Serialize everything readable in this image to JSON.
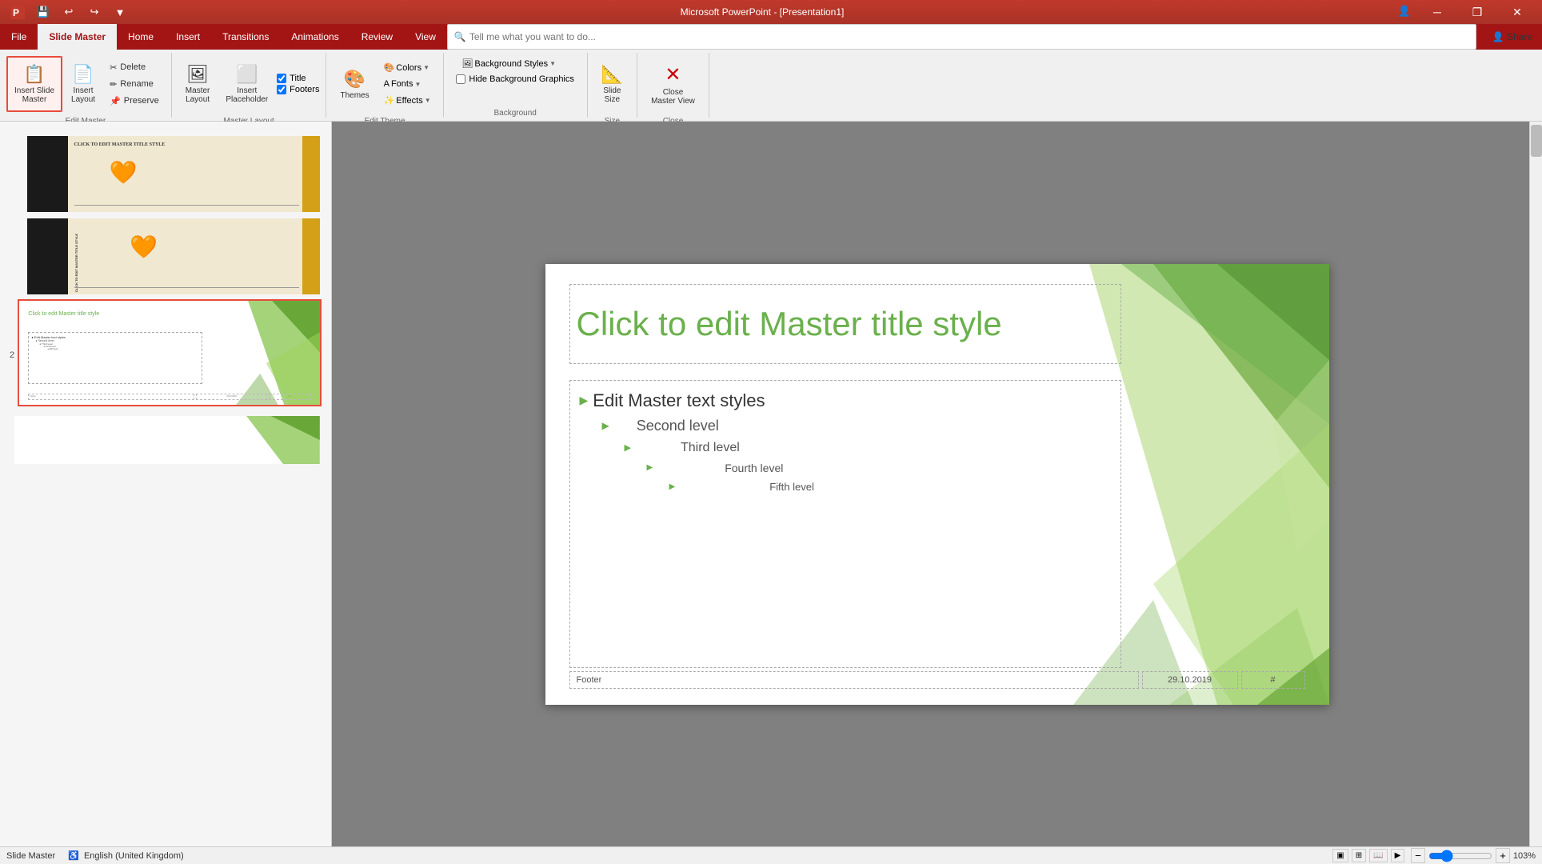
{
  "titleBar": {
    "title": "Microsoft PowerPoint - [Presentation1]",
    "quickAccess": [
      "save",
      "undo",
      "redo",
      "customize"
    ],
    "windowControls": [
      "minimize",
      "restore",
      "close"
    ]
  },
  "ribbon": {
    "tabs": [
      "File",
      "Slide Master",
      "Home",
      "Insert",
      "Transitions",
      "Animations",
      "Review",
      "View"
    ],
    "activeTab": "Slide Master",
    "groups": {
      "editMaster": {
        "label": "Edit Master",
        "buttons": {
          "insertSlideMaster": "Insert Slide\nMaster",
          "insertLayout": "Insert\nLayout",
          "delete": "Delete",
          "rename": "Rename",
          "preserve": "Preserve"
        }
      },
      "masterLayout": {
        "label": "Master Layout",
        "buttons": {
          "masterLayout": "Master\nLayout",
          "insertPlaceholder": "Insert\nPlaceholder",
          "title": "Title",
          "footers": "Footers"
        }
      },
      "editTheme": {
        "label": "Edit Theme",
        "buttons": {
          "themes": "Themes",
          "colors": "Colors",
          "fonts": "Fonts",
          "effects": "Effects"
        }
      },
      "background": {
        "label": "Background",
        "buttons": {
          "backgroundStyles": "Background Styles",
          "hideBackgroundGraphics": "Hide Background Graphics"
        }
      },
      "size": {
        "label": "Size",
        "buttons": {
          "slideSize": "Slide\nSize"
        }
      },
      "close": {
        "label": "Close",
        "buttons": {
          "closeMasterView": "Close\nMaster View"
        }
      }
    }
  },
  "slidePanel": {
    "slides": [
      {
        "id": 1,
        "selected": false
      },
      {
        "id": 2,
        "selected": true
      }
    ]
  },
  "mainSlide": {
    "title": "Click to edit Master title style",
    "contentItems": [
      {
        "level": 1,
        "text": "Edit Master text styles"
      },
      {
        "level": 2,
        "text": "Second level"
      },
      {
        "level": 3,
        "text": "Third level"
      },
      {
        "level": 4,
        "text": "Fourth level"
      },
      {
        "level": 5,
        "text": "Fifth level"
      }
    ],
    "footer": "Footer",
    "date": "29.10.2019",
    "pageNum": "#"
  },
  "statusBar": {
    "viewName": "Slide Master",
    "language": "English (United Kingdom)",
    "zoomLevel": "103%",
    "viewButtons": [
      "normal",
      "slidesorter",
      "reading",
      "slideshow"
    ]
  },
  "search": {
    "placeholder": "Tell me what you want to do..."
  },
  "share": "Share"
}
